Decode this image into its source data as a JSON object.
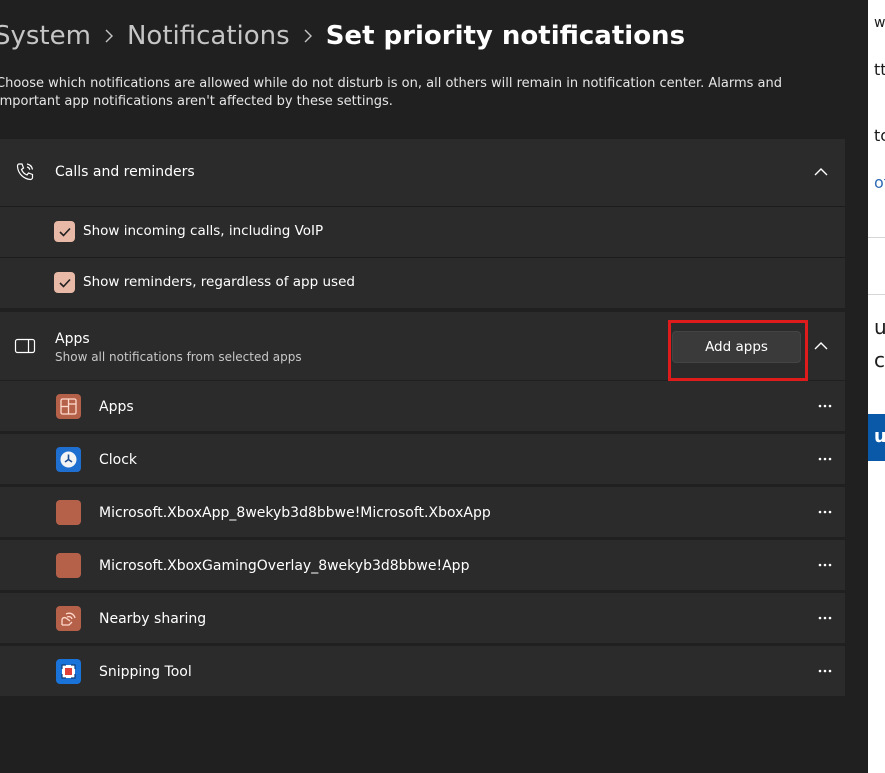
{
  "breadcrumb": {
    "items": [
      "System",
      "Notifications",
      "Set priority notifications"
    ]
  },
  "description": "Choose which notifications are allowed while do not disturb is on, all others will remain in notification center. Alarms and important app notifications aren't affected by these settings.",
  "calls": {
    "title": "Calls and reminders",
    "options": [
      {
        "label": "Show incoming calls, including VoIP",
        "checked": true
      },
      {
        "label": "Show reminders, regardless of app used",
        "checked": true
      }
    ]
  },
  "apps": {
    "title": "Apps",
    "subtitle": "Show all notifications from selected apps",
    "add_button": "Add apps",
    "list": [
      {
        "name": "Apps",
        "icon": "apps-icon"
      },
      {
        "name": "Clock",
        "icon": "clock-icon"
      },
      {
        "name": "Microsoft.XboxApp_8wekyb3d8bbwe!Microsoft.XboxApp",
        "icon": "xbox-app-icon"
      },
      {
        "name": "Microsoft.XboxGamingOverlay_8wekyb3d8bbwe!App",
        "icon": "xbox-overlay-icon"
      },
      {
        "name": "Nearby sharing",
        "icon": "nearby-sharing-icon"
      },
      {
        "name": "Snipping Tool",
        "icon": "snipping-tool-icon"
      }
    ]
  },
  "right_window": {
    "fragments": [
      "w",
      "tto",
      "to",
      "of",
      "u",
      "c",
      "u"
    ]
  },
  "colors": {
    "accent": "#e8b9a6",
    "highlight": "#e01b1b",
    "card": "#2b2b2b",
    "background": "#202020"
  }
}
